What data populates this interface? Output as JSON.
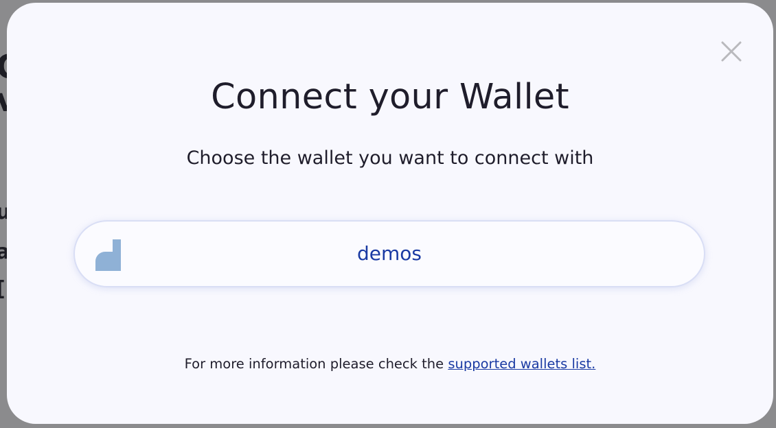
{
  "modal": {
    "title": "Connect your Wallet",
    "subtitle": "Choose the wallet you want to connect with",
    "close_icon": "close-icon",
    "wallets": [
      {
        "name": "demos",
        "icon": "demos-logo-icon"
      }
    ],
    "footer": {
      "text": "For more information please check the ",
      "link_text": "supported wallets list."
    }
  },
  "background": {
    "partial_glyphs": [
      "C",
      "v",
      "u",
      "a",
      "["
    ]
  },
  "colors": {
    "modal_bg": "#f8f8fe",
    "title_text": "#1f1d2b",
    "accent": "#1a3aa3",
    "logo": "#8fb1d6",
    "close_icon": "#b9b9bd",
    "backdrop": "#8b8b8d"
  }
}
